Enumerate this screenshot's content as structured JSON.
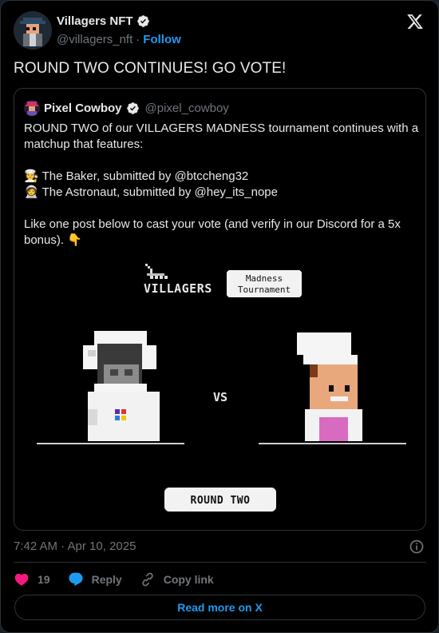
{
  "author": {
    "name": "Villagers NFT",
    "handle": "@villagers_nft",
    "separator": "·",
    "follow_label": "Follow"
  },
  "tweet": {
    "text": "ROUND TWO CONTINUES! GO VOTE!"
  },
  "quote": {
    "name": "Pixel Cowboy",
    "handle": "@pixel_cowboy",
    "line1": "ROUND TWO of our VILLAGERS MADNESS tournament continues with a matchup that features:",
    "line2": "🧑‍🍳 The Baker, submitted by @btccheng32",
    "line3": "🧑‍🚀 The Astronaut, submitted by @hey_its_nope",
    "line4": "Like one post below to cast your vote (and verify in our Discord for a 5x bonus). 👇",
    "media": {
      "logo_text": "VILLAGERS",
      "badge_line1": "Madness",
      "badge_line2": "Tournament",
      "vs_text": "VS",
      "round_label": "ROUND TWO"
    }
  },
  "meta": {
    "timestamp": "7:42 AM · Apr 10, 2025"
  },
  "actions": {
    "likes": "19",
    "reply_label": "Reply",
    "copy_label": "Copy link"
  },
  "read_more_label": "Read more on X",
  "colors": {
    "accent": "#1d9bf0",
    "like": "#f91880",
    "background": "#000000"
  }
}
